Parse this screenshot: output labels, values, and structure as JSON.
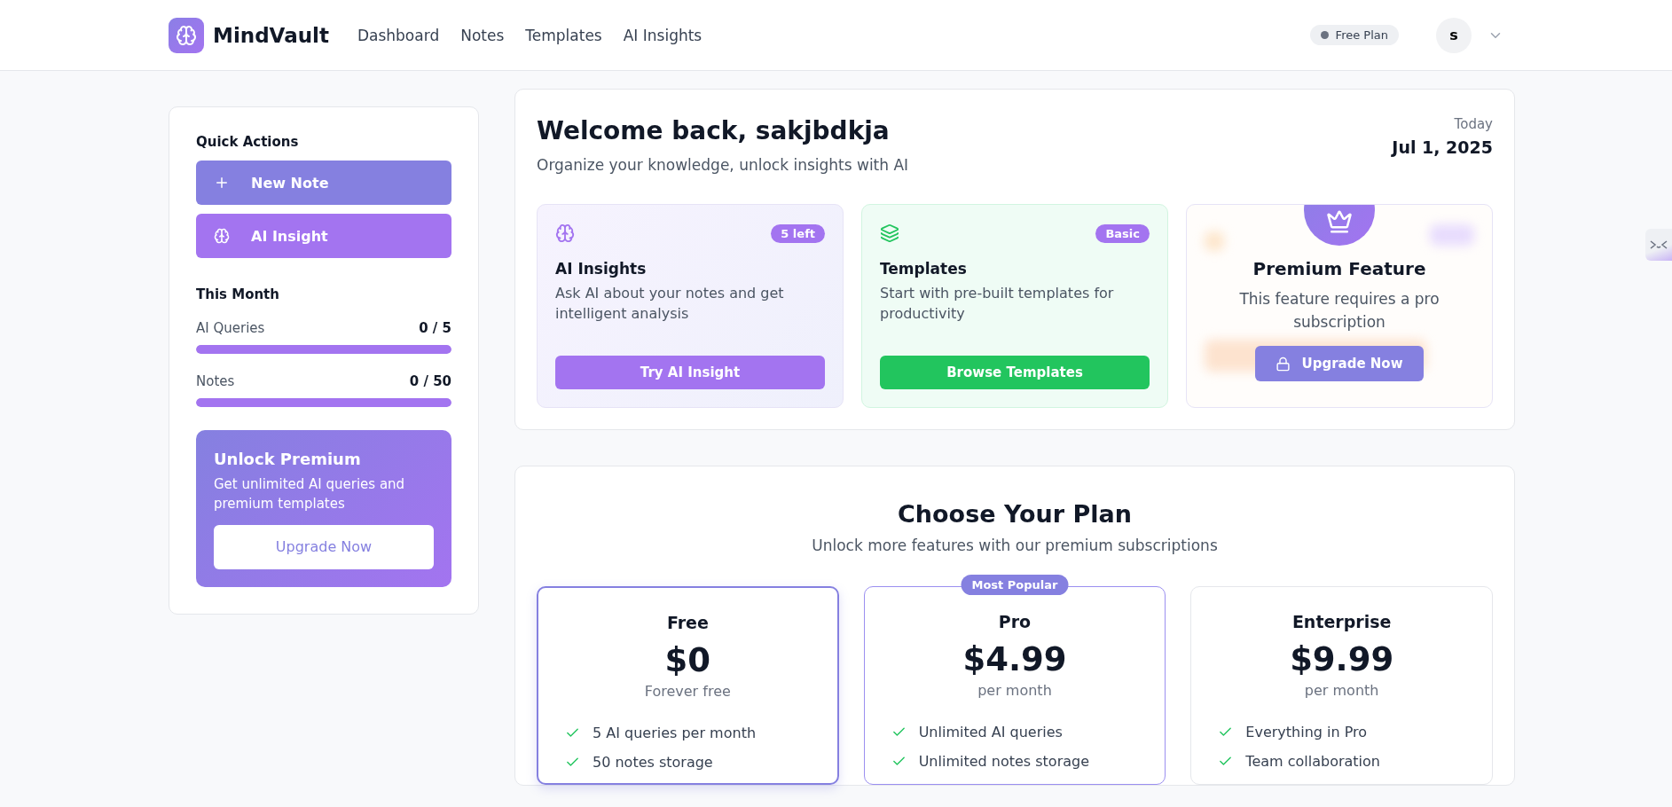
{
  "header": {
    "logo": "MindVault",
    "nav": [
      {
        "label": "Dashboard"
      },
      {
        "label": "Notes"
      },
      {
        "label": "Templates"
      },
      {
        "label": "AI Insights"
      }
    ],
    "plan_badge": "Free Plan",
    "avatar": "s"
  },
  "sidebar": {
    "quick_actions": {
      "title": "Quick Actions",
      "buttons": [
        {
          "label": "New Note",
          "kind": "plus"
        },
        {
          "label": "AI Insight",
          "kind": "brain"
        }
      ]
    },
    "this_month": {
      "title": "This Month",
      "stats": [
        {
          "label": "AI Queries",
          "value": "0 / 5",
          "level": 1
        },
        {
          "label": "Notes",
          "value": "0 / 50",
          "level": 1
        }
      ]
    },
    "promo": {
      "title": "Unlock Premium",
      "text": "Get unlimited AI queries and premium templates",
      "button": "Upgrade Now"
    }
  },
  "welcome": {
    "title": "Welcome back, sakjbdkja",
    "subtitle": "Organize your knowledge, unlock insights with AI",
    "date_label": "Today",
    "date": "Jul 1, 2025"
  },
  "features": [
    {
      "kind": "ai",
      "badge": "5 left",
      "title": "AI Insights",
      "text": "Ask AI about your notes and get intelligent analysis",
      "button": "Try AI Insight"
    },
    {
      "kind": "templates",
      "badge": "Basic",
      "title": "Templates",
      "text": "Start with pre-built templates for productivity",
      "button": "Browse Templates"
    },
    {
      "kind": "locked",
      "title": "Premium Feature",
      "text": "This feature requires a pro subscription",
      "button": "Upgrade Now"
    }
  ],
  "plans": {
    "title": "Choose Your Plan",
    "subtitle": "Unlock more features with our premium subscriptions",
    "items": [
      {
        "name": "Free",
        "price": "$0",
        "period": "Forever free",
        "selected": true,
        "features": [
          "5 AI queries per month",
          "50 notes storage"
        ]
      },
      {
        "name": "Pro",
        "price": "$4.99",
        "period": "per month",
        "selected": false,
        "badge": "Most Popular",
        "features": [
          "Unlimited AI queries",
          "Unlimited notes storage"
        ]
      },
      {
        "name": "Enterprise",
        "price": "$9.99",
        "period": "per month",
        "selected": false,
        "features": [
          "Everything in Pro",
          "Team collaboration"
        ]
      }
    ]
  }
}
